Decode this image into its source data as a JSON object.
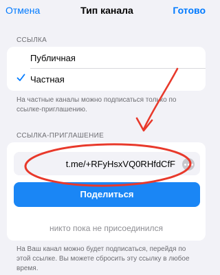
{
  "navbar": {
    "cancel": "Отмена",
    "title": "Тип канала",
    "done": "Готово"
  },
  "link_section": {
    "header": "ССЫЛКА",
    "options": [
      {
        "label": "Публичная",
        "selected": false
      },
      {
        "label": "Частная",
        "selected": true
      }
    ],
    "footer_lines": [
      "На частные каналы можно подписаться только по",
      "ссылке-приглашению."
    ]
  },
  "invite_section": {
    "header": "ССЫЛКА-ПРИГЛАШЕНИЕ",
    "link": "t.me/+RFyHsxVQ0RHfdCfF",
    "share_label": "Поделиться",
    "joined_status": "никто пока не присоединился",
    "footer_lines": [
      "На Ваш канал можно будет подписаться, перейдя по",
      "этой ссылке. Вы можете сбросить эту ссылку в любое",
      "время."
    ]
  },
  "colors": {
    "accent": "#007aff",
    "button": "#1a86f5",
    "annotation": "#e8392b"
  },
  "icons": [
    "checkmark-icon",
    "more-options-icon",
    "annotation-arrow",
    "annotation-circle"
  ]
}
